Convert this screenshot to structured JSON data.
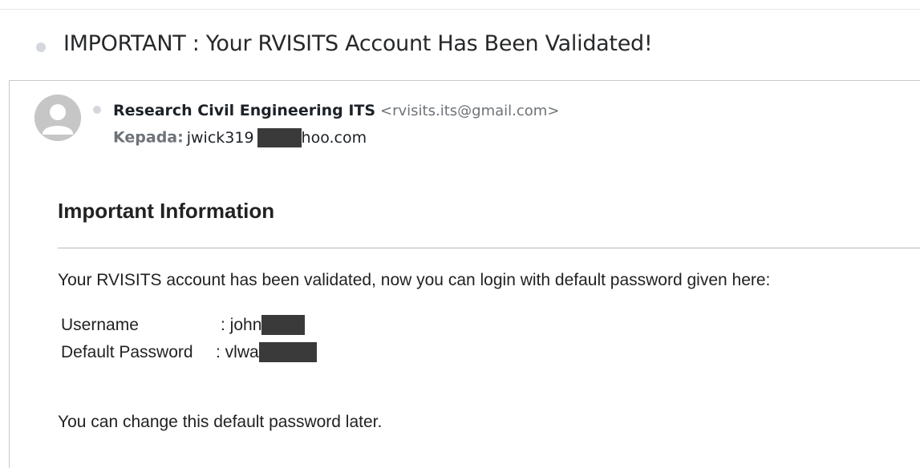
{
  "email": {
    "subject": "IMPORTANT : Your RVISITS Account Has Been Validated!",
    "sender": {
      "name": "Research Civil Engineering ITS",
      "address": "<rvisits.its@gmail.com>"
    },
    "recipient": {
      "label": "Kepada:",
      "address_start": "jwick319",
      "address_end": "hoo.com"
    },
    "body": {
      "heading": "Important Information",
      "intro": "Your RVISITS account has been validated, now you can login with default password given here:",
      "credentials": [
        {
          "label": "Username",
          "value": ": john"
        },
        {
          "label": "Default Password",
          "value": ": vlwa"
        }
      ],
      "footer": "You can change this default password later."
    }
  },
  "colors": {
    "redaction": "#3a3a3a",
    "avatar": "#c6c6c6",
    "status_dot": "#d4d7dc"
  }
}
